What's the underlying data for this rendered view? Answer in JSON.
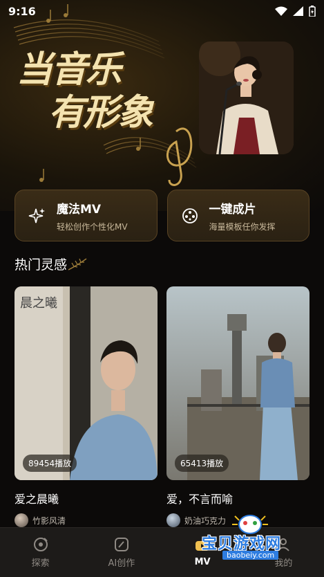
{
  "status": {
    "time": "9:16"
  },
  "hero": {
    "title_line1": "当音乐",
    "title_line2": "有形象"
  },
  "features": [
    {
      "title": "魔法MV",
      "subtitle": "轻松创作个性化MV",
      "icon": "sparkle-icon"
    },
    {
      "title": "一键成片",
      "subtitle": "海量模板任你发挥",
      "icon": "film-reel-icon"
    }
  ],
  "section": {
    "title": "热门灵感"
  },
  "cards": [
    {
      "plays": "89454播放",
      "title": "爱之晨曦",
      "author": "竹影风清",
      "overlay_text": "晨之曦"
    },
    {
      "plays": "65413播放",
      "title": "爱，不言而喻",
      "author": "奶油巧克力"
    }
  ],
  "nav": [
    {
      "label": "探索",
      "icon": "explore-icon",
      "active": false
    },
    {
      "label": "AI创作",
      "icon": "ai-create-icon",
      "active": false
    },
    {
      "label": "MV",
      "icon": "mv-icon",
      "active": true
    },
    {
      "label": "我的",
      "icon": "profile-icon",
      "active": false
    }
  ],
  "watermark": {
    "text": "宝贝游戏网",
    "url": "baobeiy.com"
  },
  "colors": {
    "accent_gold": "#f4e3b0",
    "card_bg": "#2a2113",
    "nav_bg": "#1d1b19",
    "watermark_blue": "#2e7de0"
  }
}
